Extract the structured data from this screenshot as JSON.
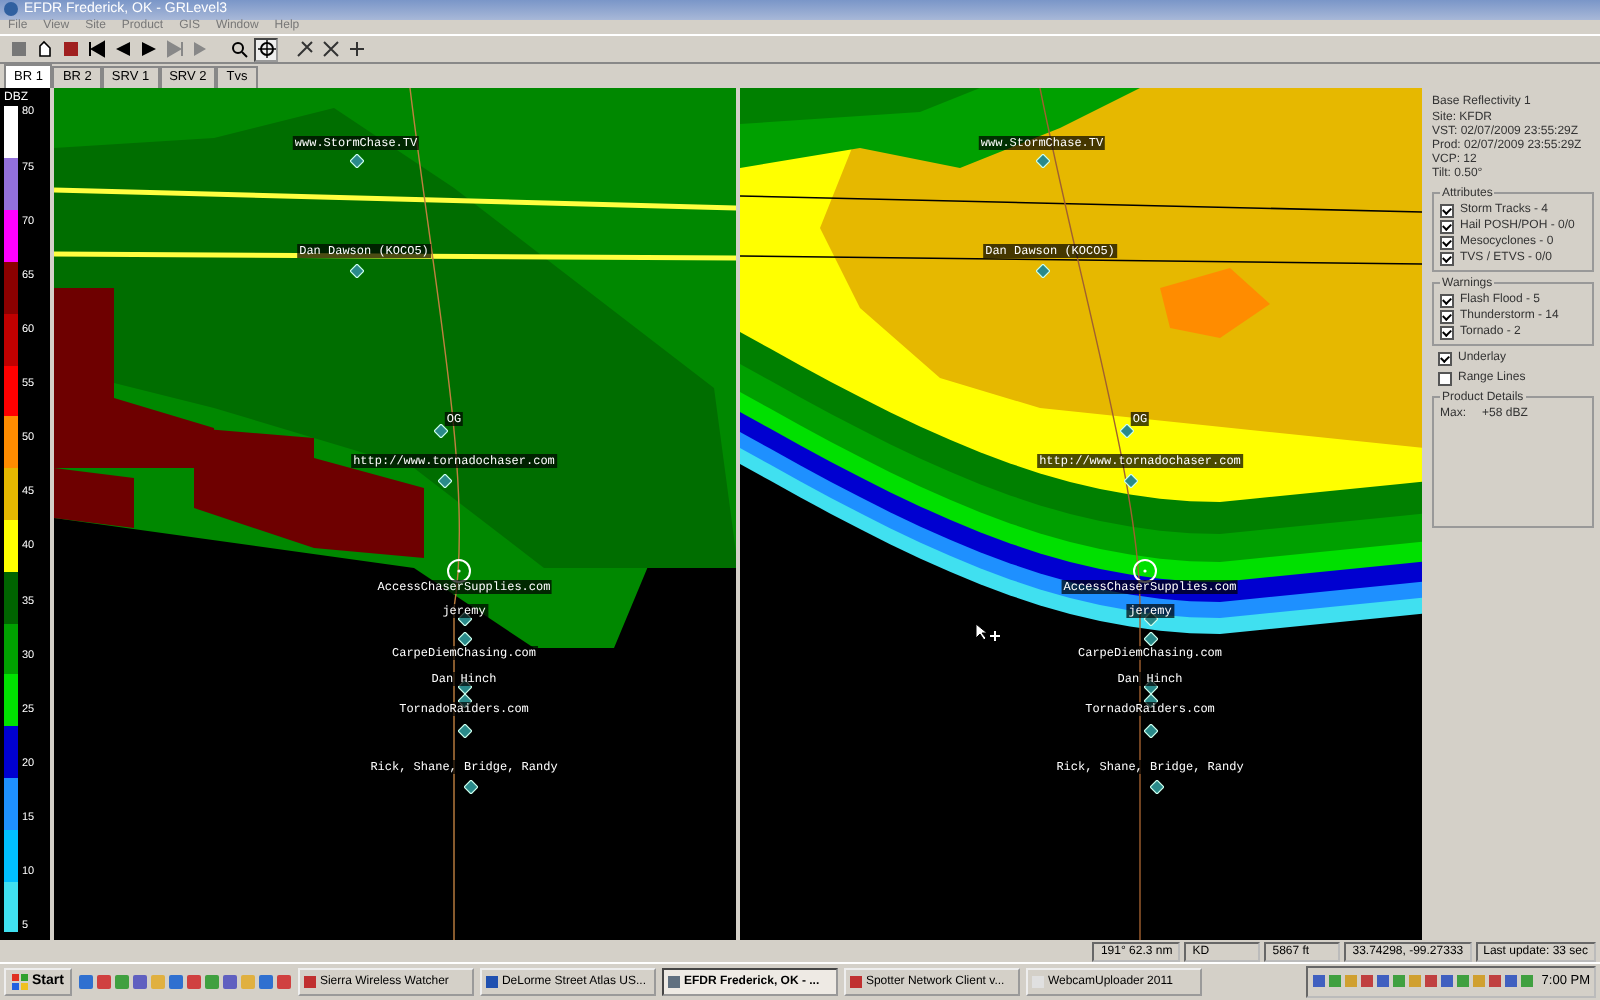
{
  "window": {
    "title": "EFDR Frederick, OK - GRLevel3"
  },
  "menu": [
    "File",
    "View",
    "Site",
    "Product",
    "GIS",
    "Window",
    "Help"
  ],
  "tabs": [
    {
      "label": "BR 1",
      "selected": true
    },
    {
      "label": "BR 2",
      "selected": false
    },
    {
      "label": "SRV 1",
      "selected": false
    },
    {
      "label": "SRV 2",
      "selected": false
    },
    {
      "label": "Tvs",
      "selected": false
    }
  ],
  "legend": {
    "title": "DBZ",
    "labels": [
      "80",
      "75",
      "70",
      "65",
      "60",
      "55",
      "50",
      "45",
      "40",
      "35",
      "30",
      "25",
      "20",
      "15",
      "10",
      "5"
    ]
  },
  "panes": [
    {
      "spotters": [
        "www.StormChase.TV",
        "Dan Dawson (KOCO5)",
        "OG",
        "http://www.tornadochaser.com",
        "AccessChaserSupplies.com",
        "jeremy",
        "CarpeDiemChasing.com",
        "Dan Hinch",
        "TornadoRaiders.com",
        "Rick, Shane, Bridge, Randy"
      ]
    },
    {
      "spotters": [
        "www.StormChase.TV",
        "Dan Dawson (KOCO5)",
        "OG",
        "http://www.tornadochaser.com",
        "AccessChaserSupplies.com",
        "jeremy",
        "CarpeDiemChasing.com",
        "Dan Hinch",
        "TornadoRaiders.com",
        "Rick, Shane, Bridge, Randy"
      ]
    }
  ],
  "panel": {
    "product": "Base Reflectivity 1",
    "info": [
      "Site: KFDR",
      "VST: 02/07/2009 23:55:29Z",
      "Prod: 02/07/2009 23:55:29Z",
      "VCP: 12",
      "Tilt: 0.50°"
    ],
    "attributes": {
      "title": "Attributes",
      "items": [
        {
          "label": "Storm Tracks - 4",
          "checked": true
        },
        {
          "label": "Hail POSH/POH - 0/0",
          "checked": true
        },
        {
          "label": "Mesocyclones - 0",
          "checked": true
        },
        {
          "label": "TVS / ETVS - 0/0",
          "checked": true
        }
      ]
    },
    "warnings": {
      "title": "Warnings",
      "items": [
        {
          "label": "Flash Flood - 5",
          "checked": true
        },
        {
          "label": "Thunderstorm - 14",
          "checked": true
        },
        {
          "label": "Tornado - 2",
          "checked": true
        }
      ]
    },
    "options": [
      {
        "label": "Underlay",
        "checked": true
      },
      {
        "label": "Range Lines",
        "checked": false
      }
    ],
    "details": {
      "title": "Product Details",
      "label": "Max:",
      "value": "+58 dBZ"
    }
  },
  "status_bar": [
    "191° 62.3 nm",
    "KD",
    "5867 ft",
    "33.74298, -99.27333",
    "Last update: 33 sec"
  ],
  "taskbar": {
    "start": "Start",
    "tasks": [
      {
        "label": "Sierra Wireless Watcher",
        "selected": false
      },
      {
        "label": "DeLorme Street Atlas US...",
        "selected": false
      },
      {
        "label": "EFDR Frederick, OK - ...",
        "selected": true
      },
      {
        "label": "Spotter Network Client v...",
        "selected": false
      },
      {
        "label": "WebcamUploader 2011",
        "selected": false
      }
    ],
    "clock": "7:00 PM"
  }
}
